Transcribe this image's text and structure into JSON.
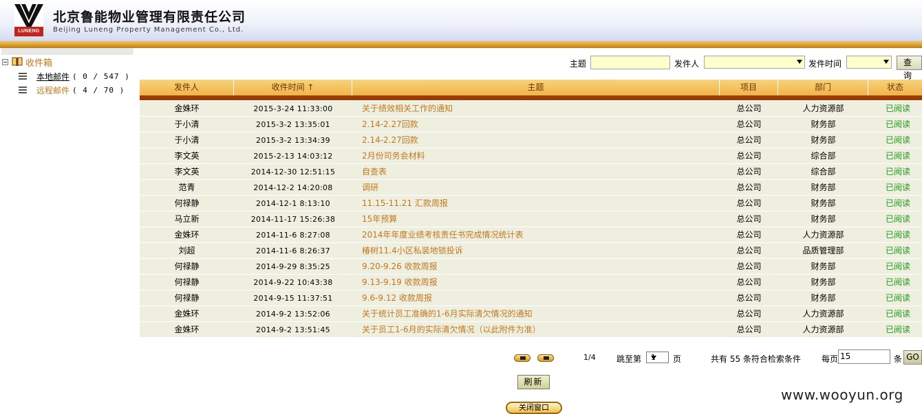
{
  "header": {
    "logo_text": "LUNENG",
    "company_cn": "北京鲁能物业管理有限责任公司",
    "company_en": "Beijing Luneng Property Management Co., Ltd."
  },
  "sidebar": {
    "root_label": "收件箱",
    "items": [
      {
        "label": "本地邮件",
        "count": "( 0 / 547 )"
      },
      {
        "label": "远程邮件",
        "count": "( 4 / 70 )"
      }
    ]
  },
  "search": {
    "subject_label": "主题",
    "subject_value": "",
    "sender_label": "发件人",
    "sender_value": "",
    "time_label": "发件时间",
    "time_value": "",
    "query_label": "查询"
  },
  "table": {
    "headers": [
      "发件人",
      "收件时间 ↑",
      "主题",
      "项目",
      "部门",
      "状态"
    ],
    "rows": [
      {
        "sender": "金姝环",
        "time": "2015-3-24 11:33:00",
        "subject": "关于绩效相关工作的通知",
        "project": "总公司",
        "dept": "人力资源部",
        "status": "已阅读"
      },
      {
        "sender": "于小清",
        "time": "2015-3-2 13:35:01",
        "subject": "2.14-2.27回款",
        "project": "总公司",
        "dept": "财务部",
        "status": "已阅读"
      },
      {
        "sender": "于小清",
        "time": "2015-3-2 13:34:39",
        "subject": "2.14-2.27回款",
        "project": "总公司",
        "dept": "财务部",
        "status": "已阅读"
      },
      {
        "sender": "李文英",
        "time": "2015-2-13 14:03:12",
        "subject": "2月份司务会材料",
        "project": "总公司",
        "dept": "综合部",
        "status": "已阅读"
      },
      {
        "sender": "李文英",
        "time": "2014-12-30 12:51:15",
        "subject": "自查表",
        "project": "总公司",
        "dept": "综合部",
        "status": "已阅读"
      },
      {
        "sender": "范青",
        "time": "2014-12-2 14:20:08",
        "subject": "调研",
        "project": "总公司",
        "dept": "财务部",
        "status": "已阅读"
      },
      {
        "sender": "何禄静",
        "time": "2014-12-1 8:13:10",
        "subject": "11.15-11.21 汇款周报",
        "project": "总公司",
        "dept": "财务部",
        "status": "已阅读"
      },
      {
        "sender": "马立新",
        "time": "2014-11-17 15:26:38",
        "subject": "15年预算",
        "project": "总公司",
        "dept": "财务部",
        "status": "已阅读"
      },
      {
        "sender": "金姝环",
        "time": "2014-11-6 8:27:08",
        "subject": "2014年年度业绩考核责任书完成情况统计表",
        "project": "总公司",
        "dept": "人力资源部",
        "status": "已阅读"
      },
      {
        "sender": "刘超",
        "time": "2014-11-6 8:26:37",
        "subject": "椿树11.4小区私装地锁投诉",
        "project": "总公司",
        "dept": "品质管理部",
        "status": "已阅读"
      },
      {
        "sender": "何禄静",
        "time": "2014-9-29 8:35:25",
        "subject": "9.20-9.26 收款周报",
        "project": "总公司",
        "dept": "财务部",
        "status": "已阅读"
      },
      {
        "sender": "何禄静",
        "time": "2014-9-22 10:43:38",
        "subject": "9.13-9.19 收款周报",
        "project": "总公司",
        "dept": "财务部",
        "status": "已阅读"
      },
      {
        "sender": "何禄静",
        "time": "2014-9-15 11:37:51",
        "subject": "9.6-9.12 收款周报",
        "project": "总公司",
        "dept": "财务部",
        "status": "已阅读"
      },
      {
        "sender": "金姝环",
        "time": "2014-9-2 13:52:06",
        "subject": "关于统计员工准确的1-6月实际清欠情况的通知",
        "project": "总公司",
        "dept": "人力资源部",
        "status": "已阅读"
      },
      {
        "sender": "金姝环",
        "time": "2014-9-2 13:51:45",
        "subject": "关于员工1-6月的实际清欠情况（以此附件为准）",
        "project": "总公司",
        "dept": "人力资源部",
        "status": "已阅读"
      }
    ]
  },
  "pagination": {
    "page_info": "1/4",
    "jump_prefix": "跳至第",
    "jump_value": "1",
    "jump_suffix": "页",
    "total_text": "共有 55 条符合检索条件",
    "per_page_label": "每页",
    "per_page_value": "15",
    "per_page_suffix": "条",
    "go_label": "GO"
  },
  "actions": {
    "refresh_label": "刷新",
    "close_label": "关闭窗口"
  },
  "watermark": "www.wooyun.org",
  "colors": {
    "header_gold": "#eeb548",
    "header_bar": "#9c3a00",
    "row_stripe": "#efefe0",
    "link": "#c07820",
    "status_read": "#1a9a1a",
    "logo_red": "#c8231b"
  }
}
